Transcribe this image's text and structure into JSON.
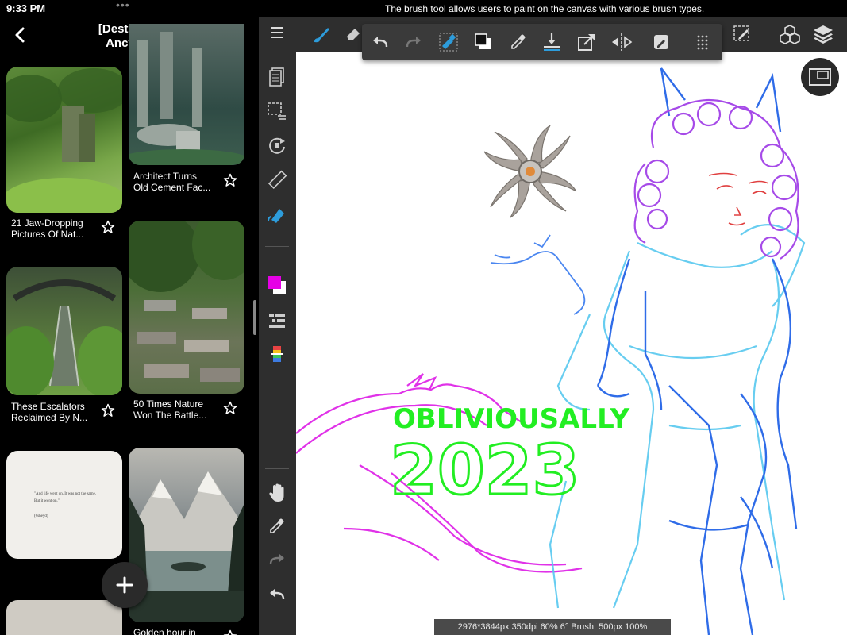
{
  "status_bar": {
    "time": "9:33 PM",
    "dots": "•••"
  },
  "tooltip": "The brush tool allows users to paint on the canvas with various brush types.",
  "board": {
    "title_line1": "[Destiny]",
    "title_line2": "Ancyn"
  },
  "pins": [
    {
      "caption_line1": "21 Jaw-Dropping",
      "caption_line2": "Pictures Of Nat..."
    },
    {
      "caption_line1": "Architect Turns",
      "caption_line2": "Old Cement Fac..."
    },
    {
      "caption_line1": "These Escalators",
      "caption_line2": "Reclaimed By N..."
    },
    {
      "caption_line1": "50 Times Nature",
      "caption_line2": "Won The Battle..."
    },
    {
      "quote_line1": "\"And life went on. It was not the same.",
      "quote_line2": "But it went on.\"",
      "quote_tag": "(#sheyd)"
    },
    {
      "caption_line1": "Golden hour in"
    }
  ],
  "canvas": {
    "watermark_line1": "OBLIVIOUSALLY",
    "watermark_line2": "2023",
    "status": "2976*3844px 350dpi 60% 6° Brush: 500px 100%"
  },
  "colors": {
    "accent_blue": "#2d9cdb",
    "primary_color": "#e600e6",
    "secondary_color": "#ffffff",
    "watermark_green": "#22ee22"
  },
  "icons": {
    "top": [
      "brush-icon",
      "eraser-icon",
      "undo-icon",
      "redo-icon",
      "magic-eraser-icon",
      "color-swap-icon",
      "eyedropper-icon",
      "save-icon",
      "export-icon",
      "symmetry-icon",
      "edit-image-icon",
      "grid-icon",
      "pen-icon",
      "3d-icon",
      "layers-icon"
    ],
    "side": [
      "menu-icon",
      "pages-icon",
      "selection-icon",
      "transform-icon",
      "ruler-icon",
      "fill-icon",
      "color-icon",
      "layer-list-icon",
      "palette-icon",
      "hand-icon",
      "eyedropper-icon",
      "redo-icon",
      "undo-icon"
    ]
  }
}
